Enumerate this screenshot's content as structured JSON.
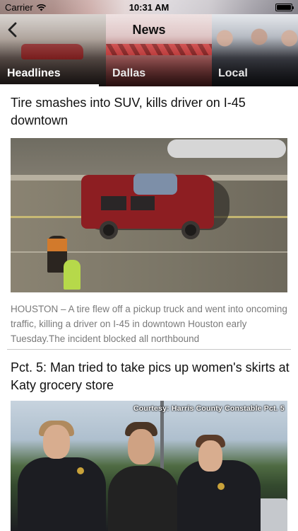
{
  "status_bar": {
    "carrier": "Carrier",
    "time": "10:31 AM",
    "icons": [
      "wifi-icon",
      "battery-icon"
    ]
  },
  "nav": {
    "title": "News",
    "back_icon": "chevron-left-icon"
  },
  "tabs": [
    {
      "label": "Headlines",
      "selected": true
    },
    {
      "label": "Dallas",
      "selected": false
    },
    {
      "label": "Local",
      "selected": false
    }
  ],
  "articles": [
    {
      "headline": "Tire smashes into SUV, kills driver on I-45 downtown",
      "summary": "HOUSTON – A tire flew off a pickup truck and went into oncoming traffic, killing a driver on I-45 in downtown Houston early Tuesday.The incident blocked all northbound"
    },
    {
      "headline": "Pct. 5: Man tried to take pics up women's skirts at Katy grocery store",
      "photo_caption": "Courtesy: Harris County Constable Pct. 5"
    }
  ],
  "colors": {
    "tab_underline": "#ffffff",
    "summary_text": "#7a7a7a",
    "divider": "#c8c8c8"
  }
}
